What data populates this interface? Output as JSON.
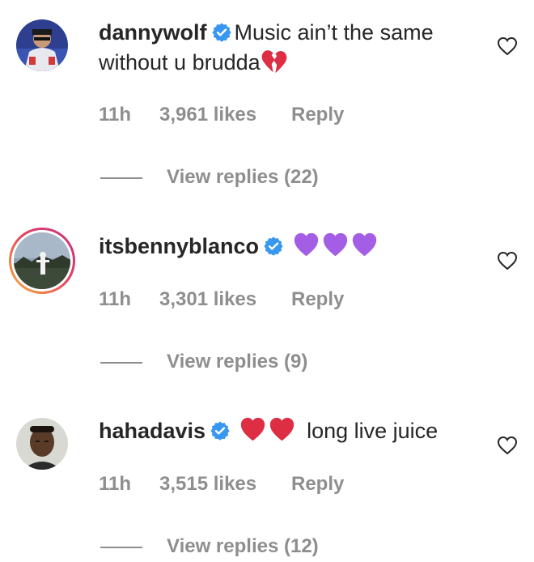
{
  "comments": [
    {
      "username": "dannywolf",
      "verified": true,
      "text_before": "Music ain’t the same without u brudda",
      "emoji_after": "broken-heart",
      "time": "11h",
      "likes": "3,961 likes",
      "reply_label": "Reply",
      "view_replies": "View replies (22)",
      "like_icon": "heart-outline-icon"
    },
    {
      "username": "itsbennyblanco",
      "verified": true,
      "emojis": [
        "purple-heart",
        "purple-heart",
        "purple-heart"
      ],
      "time": "11h",
      "likes": "3,301 likes",
      "reply_label": "Reply",
      "view_replies": "View replies (9)",
      "like_icon": "heart-outline-icon",
      "has_story_ring": true
    },
    {
      "username": "hahadavis",
      "verified": true,
      "emojis": [
        "red-heart",
        "red-heart"
      ],
      "text_after": "long live juice",
      "time": "11h",
      "likes": "3,515 likes",
      "reply_label": "Reply",
      "view_replies": "View replies (12)",
      "like_icon": "heart-outline-icon"
    }
  ],
  "colors": {
    "text": "#262626",
    "secondary": "#8e8e8e",
    "verified": "#3897f0",
    "purple_heart": "#a45ee5",
    "red_heart": "#dd2e44",
    "broken_heart": "#dd2e44"
  }
}
